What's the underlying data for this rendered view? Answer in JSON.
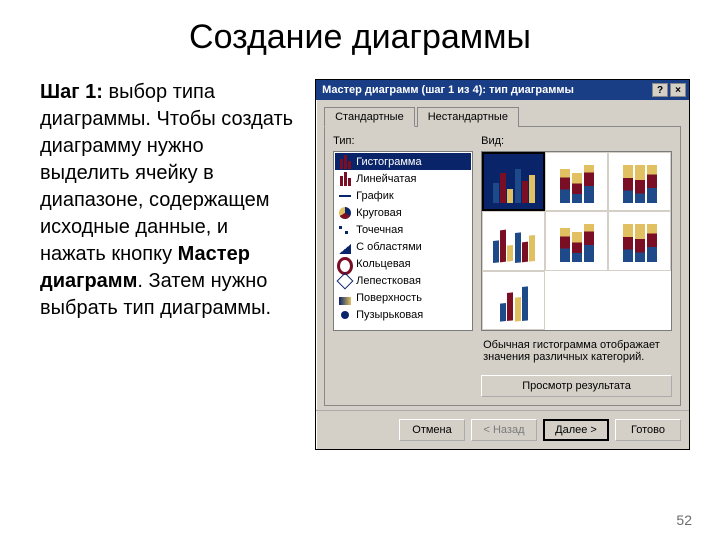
{
  "slide": {
    "title": "Создание диаграммы",
    "step_label": "Шаг 1:",
    "body_part1": " выбор типа диаграммы. Чтобы создать диаграмму нужно выделить ячейку в диапазоне, содержащем исходные данные, и нажать кнопку ",
    "wizard_term": "Мастер диаграмм",
    "body_part2": ". Затем нужно выбрать тип диаграммы.",
    "page_number": "52"
  },
  "dialog": {
    "title": "Мастер диаграмм (шаг 1 из 4): тип диаграммы",
    "help_glyph": "?",
    "close_glyph": "×",
    "tabs": {
      "standard": "Стандартные",
      "custom": "Нестандартные"
    },
    "labels": {
      "type": "Тип:",
      "view": "Вид:"
    },
    "types": [
      {
        "label": "Гистограмма",
        "icon": "bars",
        "selected": true
      },
      {
        "label": "Линейчатая",
        "icon": "bars"
      },
      {
        "label": "График",
        "icon": "line"
      },
      {
        "label": "Круговая",
        "icon": "pie"
      },
      {
        "label": "Точечная",
        "icon": "scatter"
      },
      {
        "label": "С областями",
        "icon": "area"
      },
      {
        "label": "Кольцевая",
        "icon": "ring"
      },
      {
        "label": "Лепестковая",
        "icon": "radar"
      },
      {
        "label": "Поверхность",
        "icon": "surf"
      },
      {
        "label": "Пузырьковая",
        "icon": "bubble"
      }
    ],
    "description": "Обычная гистограмма отображает значения различных категорий.",
    "preview_button": "Просмотр результата",
    "buttons": {
      "cancel": "Отмена",
      "back": "< Назад",
      "next": "Далее >",
      "finish": "Готово"
    }
  }
}
